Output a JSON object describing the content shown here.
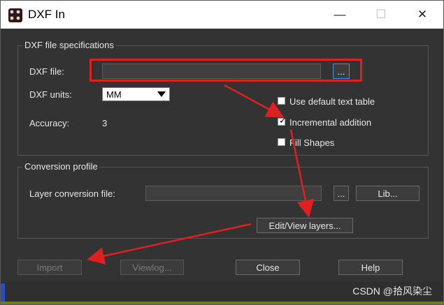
{
  "window": {
    "title": "DXF In",
    "minimize_glyph": "—",
    "maximize_glyph": "☐",
    "close_glyph": "✕"
  },
  "dxf_spec": {
    "title": "DXF file specifications",
    "file_label": "DXF file:",
    "file_value": "",
    "browse_label": "...",
    "units_label": "DXF units:",
    "units_value": "MM",
    "accuracy_label": "Accuracy:",
    "accuracy_value": "3",
    "options": [
      {
        "label": "Use default text table",
        "checked": false
      },
      {
        "label": "Incremental addition",
        "checked": true
      },
      {
        "label": "Fill Shapes",
        "checked": false
      }
    ]
  },
  "conversion": {
    "title": "Conversion profile",
    "layer_label": "Layer conversion file:",
    "layer_value": "",
    "browse_label": "...",
    "lib_label": "Lib...",
    "edit_layers_label": "Edit/View layers..."
  },
  "buttons": {
    "import": "Import",
    "viewlog": "Viewlog...",
    "close": "Close",
    "help": "Help"
  },
  "watermark": "CSDN @拾风染尘",
  "colors": {
    "annotation": "#e02020",
    "background": "#333333"
  }
}
